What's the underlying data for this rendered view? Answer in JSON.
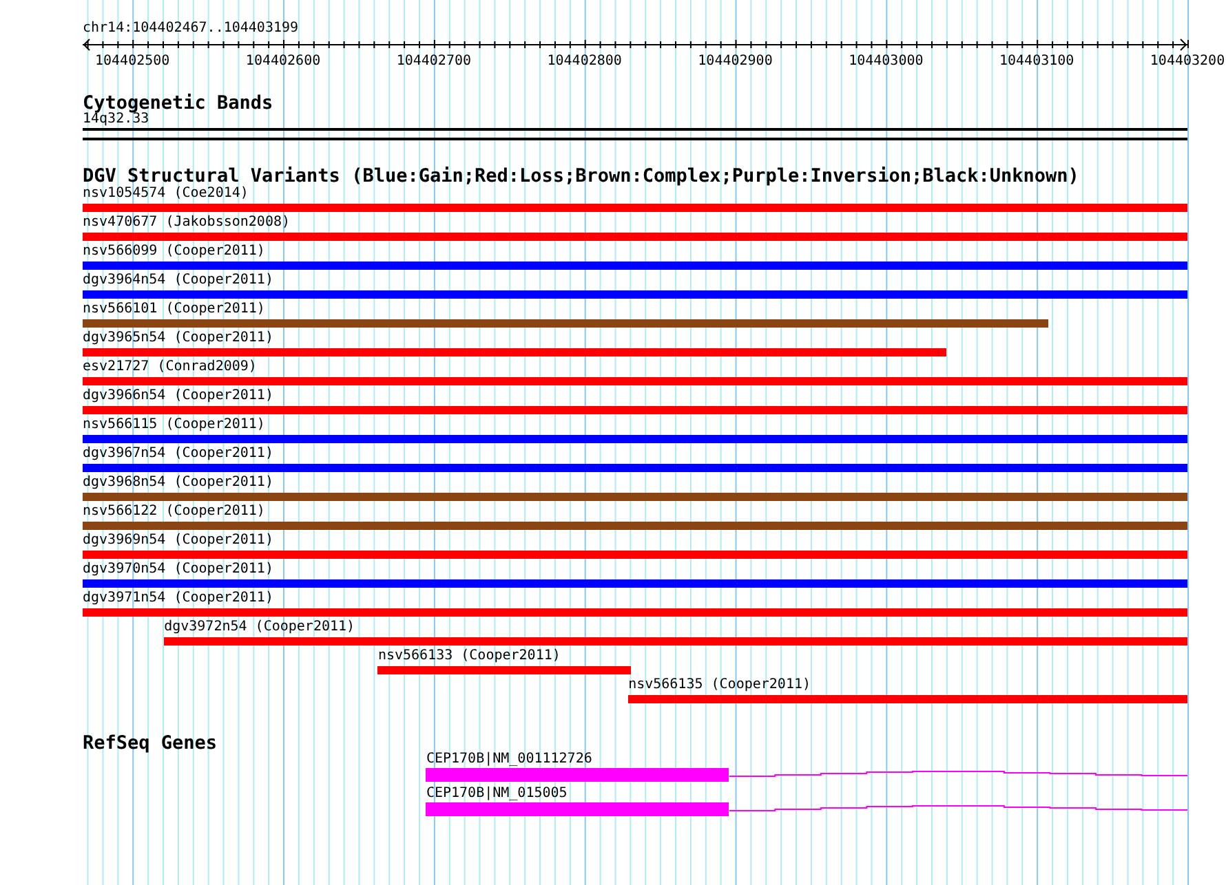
{
  "ruler": {
    "region": "chr14:104402467..104403199",
    "ticks": [
      "104402500",
      "104402600",
      "104402700",
      "104402800",
      "104402900",
      "104403000",
      "104403100",
      "104403200"
    ]
  },
  "cytogenetic_bands": {
    "title": "Cytogenetic Bands",
    "band": "14q32.33"
  },
  "dgv": {
    "title": "DGV Structural Variants (Blue:Gain;Red:Loss;Brown:Complex;Purple:Inversion;Black:Unknown)",
    "variants": [
      {
        "label": "nsv1054574 (Coe2014)",
        "color": "#ff0000"
      },
      {
        "label": "nsv470677 (Jakobsson2008)",
        "color": "#ff0000"
      },
      {
        "label": "nsv566099 (Cooper2011)",
        "color": "#0000ff"
      },
      {
        "label": "dgv3964n54 (Cooper2011)",
        "color": "#0000ff"
      },
      {
        "label": "nsv566101 (Cooper2011)",
        "color": "#8b4513"
      },
      {
        "label": "dgv3965n54 (Cooper2011)",
        "color": "#ff0000"
      },
      {
        "label": "esv21727 (Conrad2009)",
        "color": "#ff0000"
      },
      {
        "label": "dgv3966n54 (Cooper2011)",
        "color": "#ff0000"
      },
      {
        "label": "nsv566115 (Cooper2011)",
        "color": "#0000ff"
      },
      {
        "label": "dgv3967n54 (Cooper2011)",
        "color": "#0000ff"
      },
      {
        "label": "dgv3968n54 (Cooper2011)",
        "color": "#8b4513"
      },
      {
        "label": "nsv566122 (Cooper2011)",
        "color": "#8b4513"
      },
      {
        "label": "dgv3969n54 (Cooper2011)",
        "color": "#ff0000"
      },
      {
        "label": "dgv3970n54 (Cooper2011)",
        "color": "#0000ff"
      },
      {
        "label": "dgv3971n54 (Cooper2011)",
        "color": "#ff0000"
      },
      {
        "label": "dgv3972n54 (Cooper2011)",
        "color": "#ff0000"
      },
      {
        "label": "nsv566133 (Cooper2011)",
        "color": "#ff0000"
      },
      {
        "label": "nsv566135 (Cooper2011)",
        "color": "#ff0000"
      }
    ]
  },
  "refseq": {
    "title": "RefSeq Genes",
    "genes": [
      {
        "label": "CEP170B|NM_001112726"
      },
      {
        "label": "CEP170B|NM_015005"
      }
    ]
  }
}
